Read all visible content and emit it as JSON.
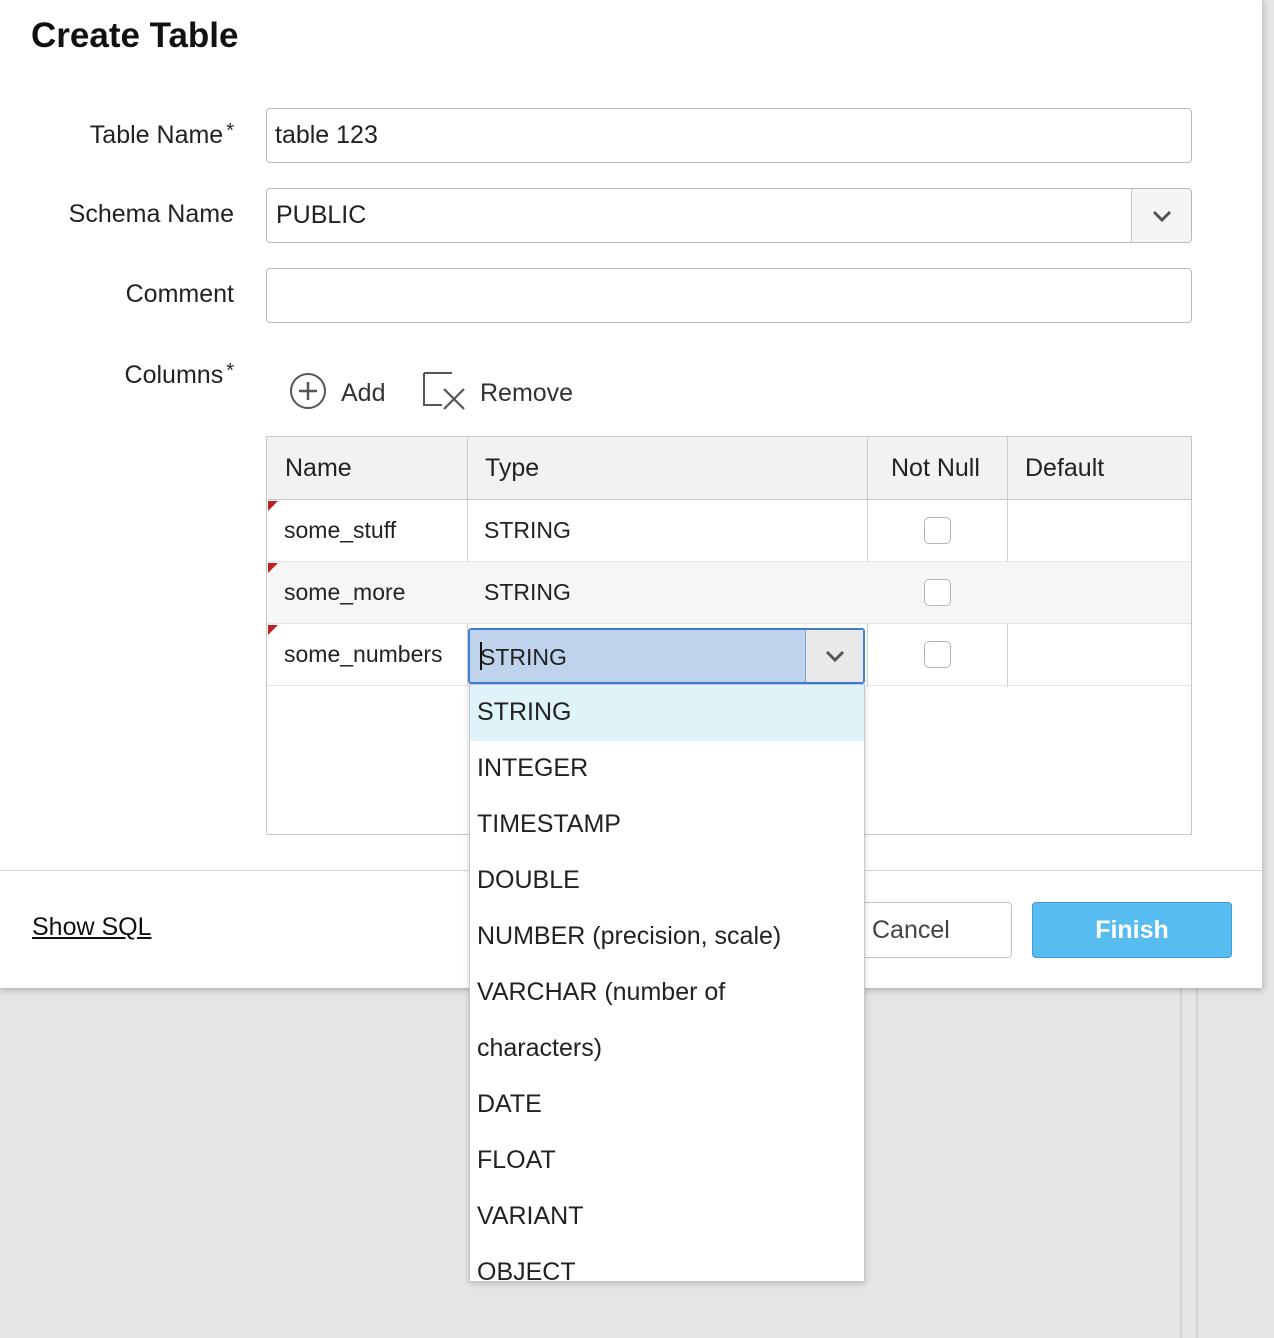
{
  "dialog": {
    "title": "Create Table",
    "table_name_label": "Table Name",
    "table_name_value": "table 123",
    "schema_name_label": "Schema Name",
    "schema_name_value": "PUBLIC",
    "comment_label": "Comment",
    "comment_value": "",
    "columns_label": "Columns",
    "required_marker": "*"
  },
  "toolbar": {
    "add_label": "Add",
    "remove_label": "Remove"
  },
  "grid": {
    "headers": [
      "Name",
      "Type",
      "Not Null",
      "Default"
    ],
    "rows": [
      {
        "name": "some_stuff",
        "type": "STRING",
        "not_null": false,
        "default": ""
      },
      {
        "name": "some_more",
        "type": "STRING",
        "not_null": false,
        "default": ""
      },
      {
        "name": "some_numbers",
        "type": "STRING",
        "not_null": false,
        "default": ""
      }
    ]
  },
  "type_dropdown": {
    "current_value": "STRING",
    "options": [
      "STRING",
      "INTEGER",
      "TIMESTAMP",
      "DOUBLE",
      "NUMBER (precision, scale)",
      "VARCHAR (number of",
      "characters)",
      "DATE",
      "FLOAT",
      "VARIANT",
      "OBJECT"
    ],
    "selected_option": "STRING"
  },
  "footer": {
    "show_sql_label": "Show SQL",
    "cancel_label": "Cancel",
    "finish_label": "Finish"
  },
  "colors": {
    "finish_button": "#57bdf0",
    "focus_border": "#3f7dd6",
    "selected_option": "#dff4f8",
    "dirty_marker": "#c0201f"
  }
}
